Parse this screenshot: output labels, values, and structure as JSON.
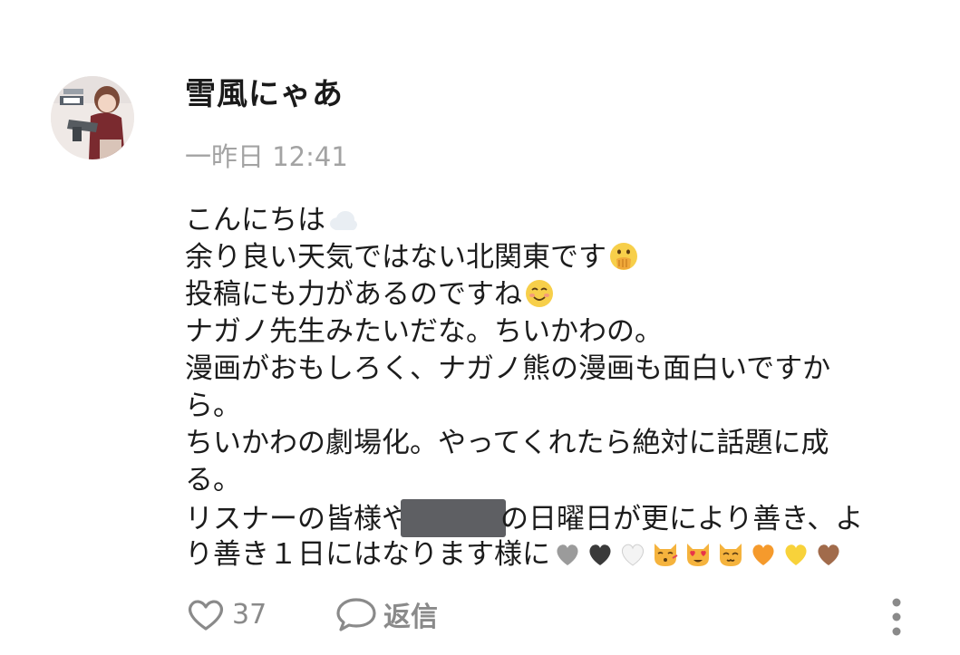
{
  "comment": {
    "author": "雪風にゃあ",
    "timestamp": "一昨日 12:41",
    "body": {
      "line1": "こんにちは",
      "line2": "余り良い天気ではない北関東です",
      "line3": "投稿にも力があるのですね",
      "line4": "ナガノ先生みたいだな。ちいかわの。",
      "line5": "漫画がおもしろく、ナガノ熊の漫画も面白いですか",
      "line6": "ら。",
      "line7": "ちいかわの劇場化。やってくれたら絶対に話題に成",
      "line8": "る。",
      "line9a": "リスナーの皆様や",
      "line9b": "の日曜日が更により善き、よ",
      "line10": "り善き１日にはなります様に"
    },
    "emojis": {
      "line1": "cloud",
      "line2": "face-with-hand-over-mouth",
      "line3": "smiling-face",
      "line10": [
        "grey-heart",
        "black-heart",
        "white-heart",
        "kissing-cat",
        "heart-eyes-cat",
        "smiling-cat",
        "orange-heart",
        "yellow-heart",
        "brown-heart"
      ]
    }
  },
  "actions": {
    "like_count": "37",
    "reply_label": "返信"
  },
  "icons": {
    "like": "heart-outline-icon",
    "reply": "speech-bubble-icon",
    "more": "more-vertical-icon"
  },
  "colors": {
    "timestamp": "#a3a3a3",
    "action_text": "#8a8a8a",
    "redaction": "#5e5f63"
  }
}
